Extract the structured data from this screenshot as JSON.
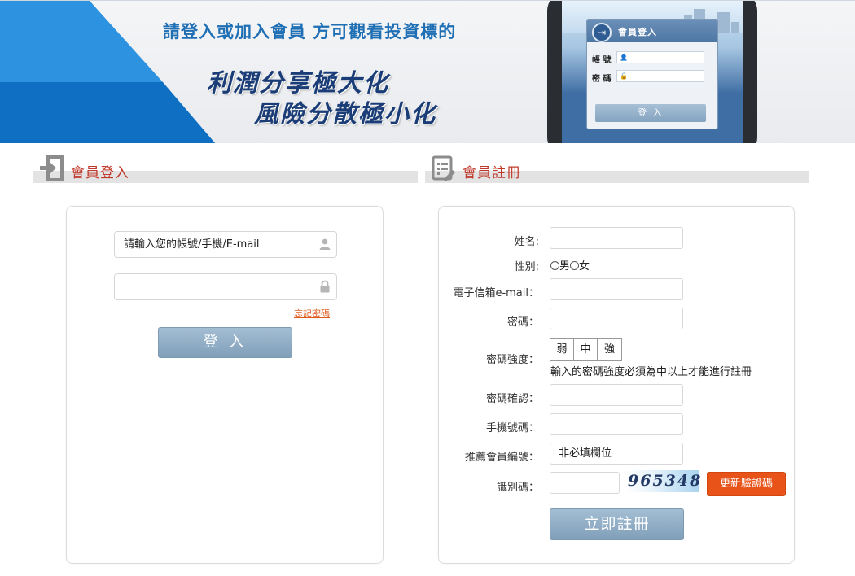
{
  "banner": {
    "headline": "請登入或加入會員  方可觀看投資標的",
    "slogan_line1": "利潤分享極大化",
    "slogan_line2": "風險分散極小化",
    "phone_card": {
      "title": "會員登入",
      "account_label": "帳 號",
      "password_label": "密 碼",
      "button": "登 入"
    }
  },
  "login_section": {
    "title": "會員登入",
    "account_value": "請輸入您的帳號/手機/E-mail",
    "password_value": "",
    "forgot_link": "忘記密碼",
    "login_button": "登 入"
  },
  "register_section": {
    "title": "會員註冊",
    "labels": {
      "name": "姓名:",
      "gender": "性別:",
      "email": "電子信箱e-mail：",
      "password": "密碼：",
      "strength": "密碼強度：",
      "confirm": "密碼確認：",
      "mobile": "手機號碼：",
      "referrer": "推薦會員編號：",
      "captcha": "識別碼："
    },
    "gender_options": [
      "男",
      "女"
    ],
    "strength_levels": [
      "弱",
      "中",
      "強"
    ],
    "strength_note": "輸入的密碼強度必須為中以上才能進行註冊",
    "referrer_value": "非必填欄位",
    "captcha_code": "965348",
    "refresh_captcha_button": "更新驗證碼",
    "submit_button": "立即註冊"
  },
  "colors": {
    "accent_red": "#c0392b",
    "button_blue": "#8eaac2",
    "button_orange": "#e8531a",
    "banner_blue": "#1f6fb5"
  },
  "icons": [
    "login-arrow-icon",
    "register-form-icon",
    "user-icon",
    "lock-icon"
  ]
}
